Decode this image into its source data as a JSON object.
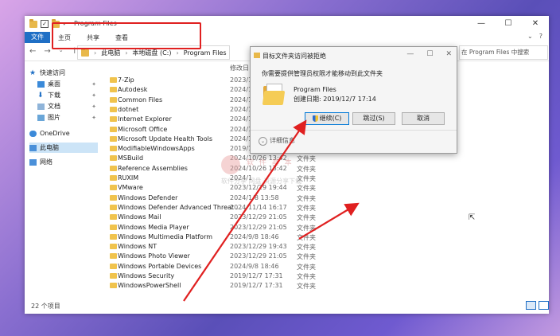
{
  "window": {
    "title": "Program Files",
    "controls": [
      "—",
      "☐",
      "✕"
    ]
  },
  "ribbon": {
    "file": "文件",
    "tabs": [
      "主页",
      "共享",
      "查看"
    ]
  },
  "address": {
    "crumbs": [
      "此电脑",
      "本地磁盘 (C:)",
      "Program Files"
    ],
    "dropdown": "⌄"
  },
  "search": {
    "placeholder": "在 Program Files 中搜索"
  },
  "sidebar": {
    "quick_access": "快速访问",
    "items": [
      "桌面",
      "下载",
      "文档",
      "图片"
    ],
    "onedrive": "OneDrive",
    "this_pc": "此电脑",
    "network": "网络"
  },
  "columns": {
    "modified": "修改日"
  },
  "files": [
    {
      "name": "7-Zip",
      "date": "2023/12",
      "type": ""
    },
    {
      "name": "Autodesk",
      "date": "2024/10",
      "type": ""
    },
    {
      "name": "Common Files",
      "date": "2024/10",
      "type": ""
    },
    {
      "name": "dotnet",
      "date": "2024/10",
      "type": ""
    },
    {
      "name": "Internet Explorer",
      "date": "2024/10",
      "type": ""
    },
    {
      "name": "Microsoft Office",
      "date": "2024/10",
      "type": ""
    },
    {
      "name": "Microsoft Update Health Tools",
      "date": "2024/10",
      "type": ""
    },
    {
      "name": "ModifiableWindowsApps",
      "date": "2019/1",
      "type": ""
    },
    {
      "name": "MSBuild",
      "date": "2024/10/26 13:42",
      "type": "文件夹"
    },
    {
      "name": "Reference Assemblies",
      "date": "2024/10/26 13:42",
      "type": "文件夹"
    },
    {
      "name": "RUXIM",
      "date": "2024/1",
      "type": "文件夹"
    },
    {
      "name": "VMware",
      "date": "2023/12/29 19:44",
      "type": "文件夹"
    },
    {
      "name": "Windows Defender",
      "date": "2024/1/8 13:58",
      "type": "文件夹"
    },
    {
      "name": "Windows Defender Advanced Threat ...",
      "date": "2024/11/14 16:17",
      "type": "文件夹"
    },
    {
      "name": "Windows Mail",
      "date": "2023/12/29 21:05",
      "type": "文件夹"
    },
    {
      "name": "Windows Media Player",
      "date": "2023/12/29 21:05",
      "type": "文件夹"
    },
    {
      "name": "Windows Multimedia Platform",
      "date": "2024/9/8 18:46",
      "type": "文件夹"
    },
    {
      "name": "Windows NT",
      "date": "2023/12/29 19:43",
      "type": "文件夹"
    },
    {
      "name": "Windows Photo Viewer",
      "date": "2023/12/29 21:05",
      "type": "文件夹"
    },
    {
      "name": "Windows Portable Devices",
      "date": "2024/9/8 18:46",
      "type": "文件夹"
    },
    {
      "name": "Windows Security",
      "date": "2019/12/7 17:31",
      "type": "文件夹"
    },
    {
      "name": "WindowsPowerShell",
      "date": "2019/12/7 17:31",
      "type": "文件夹"
    }
  ],
  "status": {
    "count": "22 个项目"
  },
  "dialog": {
    "title": "目标文件夹访问被拒绝",
    "message": "你需要提供管理员权限才能移动到此文件夹",
    "folder_name": "Program Files",
    "created": "创建日期: 2019/12/7 17:14",
    "continue": "继续(C)",
    "skip": "跳过(S)",
    "cancel": "取消",
    "more_info": "详细信息"
  },
  "watermark": {
    "line1": "软 件 基 本",
    "line2": "软件分享 网盘 资源分享下载"
  },
  "colors": {
    "accent": "#1f6fc5",
    "highlight": "#e02020",
    "folder": "#f0c34d"
  }
}
